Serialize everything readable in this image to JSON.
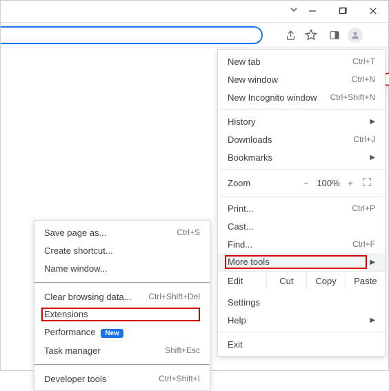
{
  "titlebar": {},
  "toolbar": {},
  "menu": {
    "new_tab": {
      "label": "New tab",
      "shortcut": "Ctrl+T"
    },
    "new_window": {
      "label": "New window",
      "shortcut": "Ctrl+N"
    },
    "new_incognito": {
      "label": "New Incognito window",
      "shortcut": "Ctrl+Shift+N"
    },
    "history": {
      "label": "History"
    },
    "downloads": {
      "label": "Downloads",
      "shortcut": "Ctrl+J"
    },
    "bookmarks": {
      "label": "Bookmarks"
    },
    "zoom": {
      "label": "Zoom",
      "value": "100%",
      "minus": "−",
      "plus": "+"
    },
    "print": {
      "label": "Print...",
      "shortcut": "Ctrl+P"
    },
    "cast": {
      "label": "Cast..."
    },
    "find": {
      "label": "Find...",
      "shortcut": "Ctrl+F"
    },
    "more_tools": {
      "label": "More tools"
    },
    "edit": {
      "label": "Edit",
      "cut": "Cut",
      "copy": "Copy",
      "paste": "Paste"
    },
    "settings": {
      "label": "Settings"
    },
    "help": {
      "label": "Help"
    },
    "exit": {
      "label": "Exit"
    }
  },
  "submenu": {
    "save_page": {
      "label": "Save page as...",
      "shortcut": "Ctrl+S"
    },
    "shortcut": {
      "label": "Create shortcut..."
    },
    "name_window": {
      "label": "Name window..."
    },
    "clear_data": {
      "label": "Clear browsing data...",
      "shortcut": "Ctrl+Shift+Del"
    },
    "extensions": {
      "label": "Extensions"
    },
    "performance": {
      "label": "Performance",
      "badge": "New"
    },
    "taskmgr": {
      "label": "Task manager",
      "shortcut": "Shift+Esc"
    },
    "devtools": {
      "label": "Developer tools",
      "shortcut": "Ctrl+Shift+I"
    }
  }
}
